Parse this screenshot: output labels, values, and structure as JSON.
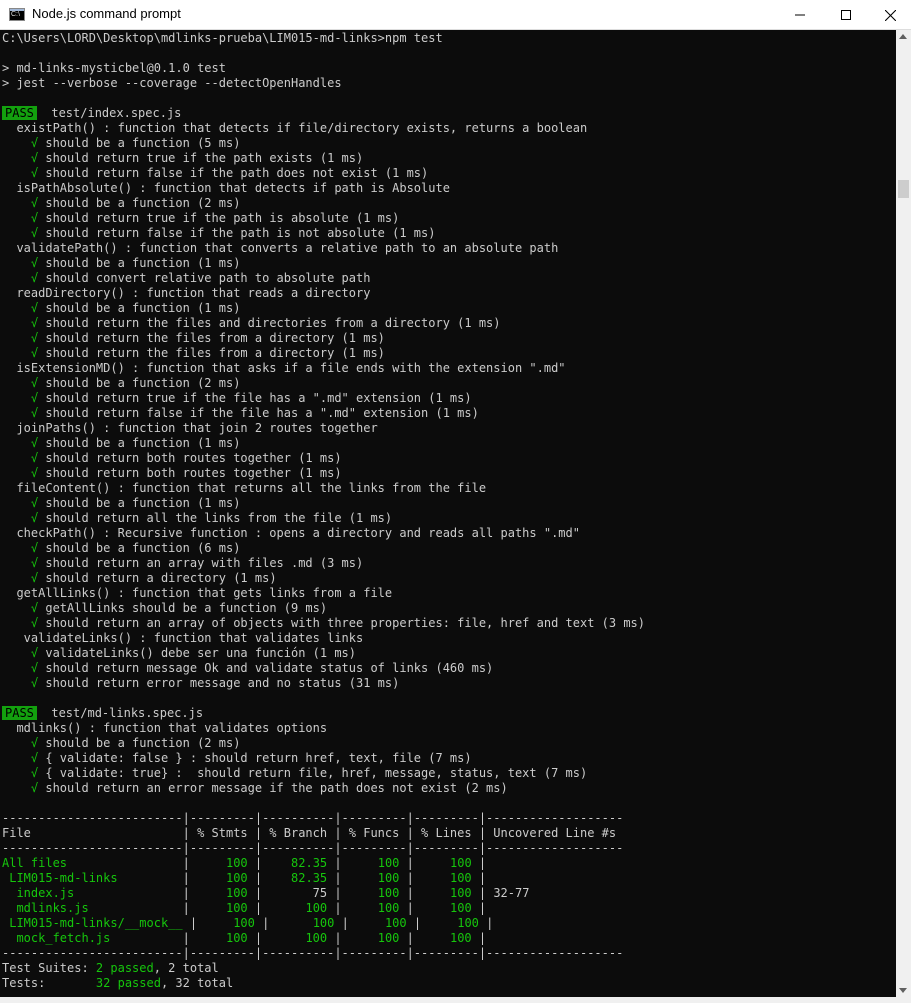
{
  "window": {
    "title": "Node.js command prompt",
    "icon_label": "C:\\"
  },
  "terminal": {
    "lines": [
      [
        {
          "t": "C:\\Users\\LORD\\Desktop\\mdlinks-prueba\\LIM015-md-links>npm test"
        }
      ],
      [],
      [
        {
          "t": "> md-links-mysticbel@0.1.0 test"
        }
      ],
      [
        {
          "t": "> jest --verbose --coverage --detectOpenHandles"
        }
      ],
      [],
      [
        {
          "t": "PASS",
          "c": "pass"
        },
        {
          "t": "  test/index.spec.js"
        }
      ],
      [
        {
          "t": "  existPath() : function that detects if file/directory exists, returns a boolean"
        }
      ],
      [
        {
          "t": "    √",
          "c": "ok"
        },
        {
          "t": " should be a function (5 ms)"
        }
      ],
      [
        {
          "t": "    √",
          "c": "ok"
        },
        {
          "t": " should return true if the path exists (1 ms)"
        }
      ],
      [
        {
          "t": "    √",
          "c": "ok"
        },
        {
          "t": " should return false if the path does not exist (1 ms)"
        }
      ],
      [
        {
          "t": "  isPathAbsolute() : function that detects if path is Absolute"
        }
      ],
      [
        {
          "t": "    √",
          "c": "ok"
        },
        {
          "t": " should be a function (2 ms)"
        }
      ],
      [
        {
          "t": "    √",
          "c": "ok"
        },
        {
          "t": " should return true if the path is absolute (1 ms)"
        }
      ],
      [
        {
          "t": "    √",
          "c": "ok"
        },
        {
          "t": " should return false if the path is not absolute (1 ms)"
        }
      ],
      [
        {
          "t": "  validatePath() : function that converts a relative path to an absolute path"
        }
      ],
      [
        {
          "t": "    √",
          "c": "ok"
        },
        {
          "t": " should be a function (1 ms)"
        }
      ],
      [
        {
          "t": "    √",
          "c": "ok"
        },
        {
          "t": " should convert relative path to absolute path"
        }
      ],
      [
        {
          "t": "  readDirectory() : function that reads a directory"
        }
      ],
      [
        {
          "t": "    √",
          "c": "ok"
        },
        {
          "t": " should be a function (1 ms)"
        }
      ],
      [
        {
          "t": "    √",
          "c": "ok"
        },
        {
          "t": " should return the files and directories from a directory (1 ms)"
        }
      ],
      [
        {
          "t": "    √",
          "c": "ok"
        },
        {
          "t": " should return the files from a directory (1 ms)"
        }
      ],
      [
        {
          "t": "    √",
          "c": "ok"
        },
        {
          "t": " should return the files from a directory (1 ms)"
        }
      ],
      [
        {
          "t": "  isExtensionMD() : function that asks if a file ends with the extension \".md\""
        }
      ],
      [
        {
          "t": "    √",
          "c": "ok"
        },
        {
          "t": " should be a function (2 ms)"
        }
      ],
      [
        {
          "t": "    √",
          "c": "ok"
        },
        {
          "t": " should return true if the file has a \".md\" extension (1 ms)"
        }
      ],
      [
        {
          "t": "    √",
          "c": "ok"
        },
        {
          "t": " should return false if the file has a \".md\" extension (1 ms)"
        }
      ],
      [
        {
          "t": "  joinPaths() : function that join 2 routes together"
        }
      ],
      [
        {
          "t": "    √",
          "c": "ok"
        },
        {
          "t": " should be a function (1 ms)"
        }
      ],
      [
        {
          "t": "    √",
          "c": "ok"
        },
        {
          "t": " should return both routes together (1 ms)"
        }
      ],
      [
        {
          "t": "    √",
          "c": "ok"
        },
        {
          "t": " should return both routes together (1 ms)"
        }
      ],
      [
        {
          "t": "  fileContent() : function that returns all the links from the file"
        }
      ],
      [
        {
          "t": "    √",
          "c": "ok"
        },
        {
          "t": " should be a function (1 ms)"
        }
      ],
      [
        {
          "t": "    √",
          "c": "ok"
        },
        {
          "t": " should return all the links from the file (1 ms)"
        }
      ],
      [
        {
          "t": "  checkPath() : Recursive function : opens a directory and reads all paths \".md\""
        }
      ],
      [
        {
          "t": "    √",
          "c": "ok"
        },
        {
          "t": " should be a function (6 ms)"
        }
      ],
      [
        {
          "t": "    √",
          "c": "ok"
        },
        {
          "t": " should return an array with files .md (3 ms)"
        }
      ],
      [
        {
          "t": "    √",
          "c": "ok"
        },
        {
          "t": " should return a directory (1 ms)"
        }
      ],
      [
        {
          "t": "  getAllLinks() : function that gets links from a file"
        }
      ],
      [
        {
          "t": "    √",
          "c": "ok"
        },
        {
          "t": " getAllLinks should be a function (9 ms)"
        }
      ],
      [
        {
          "t": "    √",
          "c": "ok"
        },
        {
          "t": " should return an array of objects with three properties: file, href and text (3 ms)"
        }
      ],
      [
        {
          "t": "   validateLinks() : function that validates links"
        }
      ],
      [
        {
          "t": "    √",
          "c": "ok"
        },
        {
          "t": " validateLinks() debe ser una función (1 ms)"
        }
      ],
      [
        {
          "t": "    √",
          "c": "ok"
        },
        {
          "t": " should return message Ok and validate status of links (460 ms)"
        }
      ],
      [
        {
          "t": "    √",
          "c": "ok"
        },
        {
          "t": " should return error message and no status (31 ms)"
        }
      ],
      [],
      [
        {
          "t": "PASS",
          "c": "pass"
        },
        {
          "t": "  test/md-links.spec.js"
        }
      ],
      [
        {
          "t": "  mdlinks() : function that validates options"
        }
      ],
      [
        {
          "t": "    √",
          "c": "ok"
        },
        {
          "t": " should be a function (2 ms)"
        }
      ],
      [
        {
          "t": "    √",
          "c": "ok"
        },
        {
          "t": " { validate: false } : should return href, text, file (7 ms)"
        }
      ],
      [
        {
          "t": "    √",
          "c": "ok"
        },
        {
          "t": " { validate: true} :  should return file, href, message, status, text (7 ms)"
        }
      ],
      [
        {
          "t": "    √",
          "c": "ok"
        },
        {
          "t": " should return an error message if the path does not exist (2 ms)"
        }
      ],
      [],
      [
        {
          "t": "-------------------------|---------|----------|---------|---------|-------------------"
        }
      ],
      [
        {
          "t": "File                     | % Stmts | % Branch | % Funcs | % Lines | Uncovered Line #s "
        }
      ],
      [
        {
          "t": "-------------------------|---------|----------|---------|---------|-------------------"
        }
      ],
      [
        {
          "t": "All files",
          "c": "ok"
        },
        {
          "t": "                |     "
        },
        {
          "t": "100",
          "c": "ok"
        },
        {
          "t": " |    "
        },
        {
          "t": "82.35",
          "c": "ok"
        },
        {
          "t": " |     "
        },
        {
          "t": "100",
          "c": "ok"
        },
        {
          "t": " |     "
        },
        {
          "t": "100",
          "c": "ok"
        },
        {
          "t": " |                   "
        }
      ],
      [
        {
          "t": " LIM015-md-links",
          "c": "ok"
        },
        {
          "t": "         |     "
        },
        {
          "t": "100",
          "c": "ok"
        },
        {
          "t": " |    "
        },
        {
          "t": "82.35",
          "c": "ok"
        },
        {
          "t": " |     "
        },
        {
          "t": "100",
          "c": "ok"
        },
        {
          "t": " |     "
        },
        {
          "t": "100",
          "c": "ok"
        },
        {
          "t": " |                   "
        }
      ],
      [
        {
          "t": "  index.js",
          "c": "ok"
        },
        {
          "t": "               |     "
        },
        {
          "t": "100",
          "c": "ok"
        },
        {
          "t": " |       75 |     "
        },
        {
          "t": "100",
          "c": "ok"
        },
        {
          "t": " |     "
        },
        {
          "t": "100",
          "c": "ok"
        },
        {
          "t": " | 32-77             "
        }
      ],
      [
        {
          "t": "  mdlinks.js",
          "c": "ok"
        },
        {
          "t": "             |     "
        },
        {
          "t": "100",
          "c": "ok"
        },
        {
          "t": " |      "
        },
        {
          "t": "100",
          "c": "ok"
        },
        {
          "t": " |     "
        },
        {
          "t": "100",
          "c": "ok"
        },
        {
          "t": " |     "
        },
        {
          "t": "100",
          "c": "ok"
        },
        {
          "t": " |                   "
        }
      ],
      [
        {
          "t": " LIM015-md-links/__mock__",
          "c": "ok"
        },
        {
          "t": " |     "
        },
        {
          "t": "100",
          "c": "ok"
        },
        {
          "t": " |      "
        },
        {
          "t": "100",
          "c": "ok"
        },
        {
          "t": " |     "
        },
        {
          "t": "100",
          "c": "ok"
        },
        {
          "t": " |     "
        },
        {
          "t": "100",
          "c": "ok"
        },
        {
          "t": " |                   "
        }
      ],
      [
        {
          "t": "  mock_fetch.js",
          "c": "ok"
        },
        {
          "t": "          |     "
        },
        {
          "t": "100",
          "c": "ok"
        },
        {
          "t": " |      "
        },
        {
          "t": "100",
          "c": "ok"
        },
        {
          "t": " |     "
        },
        {
          "t": "100",
          "c": "ok"
        },
        {
          "t": " |     "
        },
        {
          "t": "100",
          "c": "ok"
        },
        {
          "t": " |                   "
        }
      ],
      [
        {
          "t": "-------------------------|---------|----------|---------|---------|-------------------"
        }
      ],
      [
        {
          "t": "Test Suites: "
        },
        {
          "t": "2 passed",
          "c": "ok"
        },
        {
          "t": ", 2 total"
        }
      ],
      [
        {
          "t": "Tests:       "
        },
        {
          "t": "32 passed",
          "c": "ok"
        },
        {
          "t": ", 32 total"
        }
      ]
    ]
  },
  "colors": {
    "background": "#0c0c0c",
    "text": "#cccccc",
    "success": "#16c60c",
    "pass_badge": "#13a10e"
  }
}
